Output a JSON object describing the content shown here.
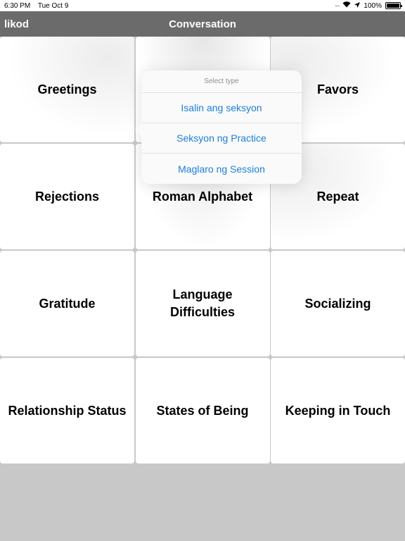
{
  "status_bar": {
    "time": "6:30 PM",
    "date": "Tue Oct 9",
    "battery": "100%",
    "icons": [
      "signal-dots-icon",
      "wifi-icon",
      "location-arrow-icon",
      "battery-icon"
    ]
  },
  "nav": {
    "back_label": "likod",
    "title": "Conversation"
  },
  "grid": {
    "cells": [
      "Greetings",
      "",
      "Favors",
      "Rejections",
      "Roman Alphabet",
      "Repeat",
      "Gratitude",
      "Language Difficulties",
      "Socializing",
      "Relationship Status",
      "States of Being",
      "Keeping in Touch"
    ]
  },
  "popover": {
    "header": "Select type",
    "options": [
      "Isalin ang seksyon",
      "Seksyon ng Practice",
      "Maglaro ng Session"
    ]
  },
  "colors": {
    "nav_bg": "#6b6b6b",
    "background": "#c8c8c8",
    "link_blue": "#1a7fd9"
  }
}
